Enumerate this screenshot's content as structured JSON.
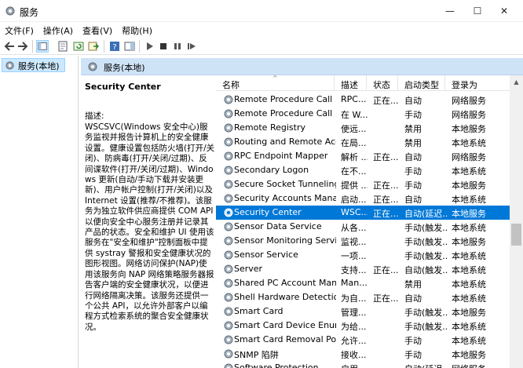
{
  "window": {
    "title": "服务",
    "minimize": "—",
    "maximize": "☐",
    "close": "✕"
  },
  "menu": [
    "文件(F)",
    "操作(A)",
    "查看(V)",
    "帮助(H)"
  ],
  "tree": {
    "root_label": "服务(本地)"
  },
  "pane_header": {
    "title": "服务(本地)"
  },
  "details": {
    "title": "Security Center",
    "label": "描述:",
    "text": "WSCSVC(Windows 安全中心)服务监视并报告计算机上的安全健康设置。健康设置包括防火墙(打开/关闭)、防病毒(打开/关闭/过期)、反间谍软件(打开/关闭/过期)、Windows 更新(自动/手动下载并安装更新)、用户帐户控制(打开/关闭)以及 Internet 设置(推荐/不推荐)。该服务为独立软件供应商提供 COM API 以便向安全中心服务注册并记录其产品的状态。安全和维护 UI 使用该服务在\"安全和维护\"控制面板中提供 systray 警报和安全健康状况的图形视图。网络访问保护(NAP)使用该服务向 NAP 网络策略服务器报告客户端的安全健康状况，以便进行网络隔离决策。该服务还提供一个公共 API，以允许外部客户以编程方式检索系统的聚合安全健康状况。"
  },
  "columns": {
    "name": "名称",
    "desc": "描述",
    "status": "状态",
    "startup": "启动类型",
    "logon": "登录为"
  },
  "services": [
    {
      "name": "Remote Procedure Call ...",
      "desc": "RPC...",
      "status": "正在...",
      "startup": "自动",
      "logon": "网络服务",
      "selected": false
    },
    {
      "name": "Remote Procedure Call ...",
      "desc": "在 W...",
      "status": "",
      "startup": "手动",
      "logon": "网络服务",
      "selected": false
    },
    {
      "name": "Remote Registry",
      "desc": "使远...",
      "status": "",
      "startup": "禁用",
      "logon": "本地服务",
      "selected": false
    },
    {
      "name": "Routing and Remote Acc...",
      "desc": "在局...",
      "status": "",
      "startup": "禁用",
      "logon": "本地系统",
      "selected": false
    },
    {
      "name": "RPC Endpoint Mapper",
      "desc": "解析 ...",
      "status": "正在...",
      "startup": "自动",
      "logon": "网络服务",
      "selected": false
    },
    {
      "name": "Secondary Logon",
      "desc": "在不...",
      "status": "",
      "startup": "手动",
      "logon": "本地系统",
      "selected": false
    },
    {
      "name": "Secure Socket Tunneling ...",
      "desc": "提供 ...",
      "status": "正在...",
      "startup": "手动",
      "logon": "本地服务",
      "selected": false
    },
    {
      "name": "Security Accounts Manag...",
      "desc": "启动...",
      "status": "正在...",
      "startup": "自动",
      "logon": "本地系统",
      "selected": false
    },
    {
      "name": "Security Center",
      "desc": "WSC...",
      "status": "正在...",
      "startup": "自动(延迟...",
      "logon": "本地服务",
      "selected": true
    },
    {
      "name": "Sensor Data Service",
      "desc": "从各...",
      "status": "",
      "startup": "手动(触发...",
      "logon": "本地系统",
      "selected": false
    },
    {
      "name": "Sensor Monitoring Service",
      "desc": "监视...",
      "status": "",
      "startup": "手动(触发...",
      "logon": "本地服务",
      "selected": false
    },
    {
      "name": "Sensor Service",
      "desc": "一项...",
      "status": "",
      "startup": "手动(触发...",
      "logon": "本地系统",
      "selected": false
    },
    {
      "name": "Server",
      "desc": "支持...",
      "status": "正在...",
      "startup": "自动(触发...",
      "logon": "本地系统",
      "selected": false
    },
    {
      "name": "Shared PC Account Mana...",
      "desc": "Man...",
      "status": "",
      "startup": "禁用",
      "logon": "本地系统",
      "selected": false
    },
    {
      "name": "Shell Hardware Detection",
      "desc": "为自...",
      "status": "正在...",
      "startup": "自动",
      "logon": "本地系统",
      "selected": false
    },
    {
      "name": "Smart Card",
      "desc": "管理...",
      "status": "",
      "startup": "手动(触发...",
      "logon": "本地服务",
      "selected": false
    },
    {
      "name": "Smart Card Device Enum...",
      "desc": "为给...",
      "status": "",
      "startup": "手动(触发...",
      "logon": "本地系统",
      "selected": false
    },
    {
      "name": "Smart Card Removal Poli...",
      "desc": "允许...",
      "status": "",
      "startup": "手动",
      "logon": "本地系统",
      "selected": false
    },
    {
      "name": "SNMP 陷阱",
      "desc": "接收...",
      "status": "",
      "startup": "手动",
      "logon": "本地服务",
      "selected": false
    },
    {
      "name": "Software Protection",
      "desc": "启用...",
      "status": "",
      "startup": "自动(延迟...",
      "logon": "网络服务",
      "selected": false
    }
  ],
  "icons": {
    "app": "gear-icon",
    "service": "gear-icon"
  },
  "colors": {
    "selection": "#0078d7",
    "header_band": "#cfe3f7",
    "tree_selection": "#cce8ff"
  }
}
